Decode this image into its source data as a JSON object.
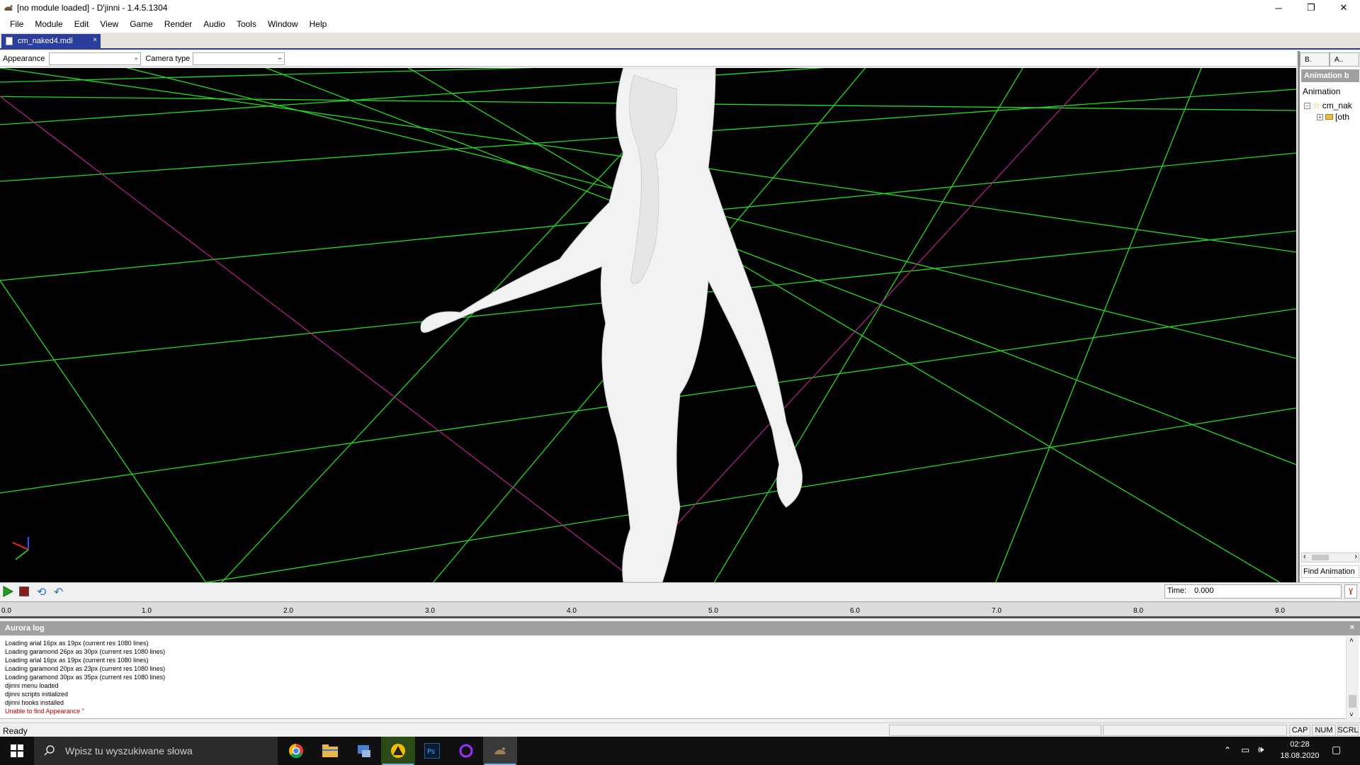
{
  "window": {
    "title": "[no module loaded] - D'jinni - 1.4.5.1304",
    "minimize_glyph": "─",
    "maximize_glyph": "❐",
    "close_glyph": "✕"
  },
  "menu": [
    "File",
    "Module",
    "Edit",
    "View",
    "Game",
    "Render",
    "Audio",
    "Tools",
    "Window",
    "Help"
  ],
  "doc_tab": {
    "label": "cm_naked4.mdl",
    "close_glyph": "×"
  },
  "toolbar": {
    "appearance_label": "Appearance",
    "appearance_value": "",
    "camera_label": "Camera type",
    "camera_value": ""
  },
  "right_panel": {
    "tabs": [
      "B.",
      "A.."
    ],
    "header": "Animation b",
    "section_label": "Animation",
    "tree": [
      {
        "label": "cm_nak",
        "icon": "star-icon",
        "expander": "−"
      },
      {
        "label": "[oth",
        "icon": "folder-icon",
        "expander": "+"
      }
    ],
    "find_label": "Find Animation"
  },
  "playback": {
    "time_label": "Time:",
    "time_value": "0.000"
  },
  "timeline": {
    "ticks": [
      "0.0",
      "1.0",
      "2.0",
      "3.0",
      "4.0",
      "5.0",
      "6.0",
      "7.0",
      "8.0",
      "9.0"
    ]
  },
  "log": {
    "title": "Aurora log",
    "close_glyph": "×",
    "lines": [
      {
        "text": "Loading arial 16px as 19px (current res 1080 lines)",
        "error": false
      },
      {
        "text": "Loading garamond 26px as 30px (current res 1080 lines)",
        "error": false
      },
      {
        "text": "Loading arial 16px as 19px (current res 1080 lines)",
        "error": false
      },
      {
        "text": "Loading garamond 20px as 23px (current res 1080 lines)",
        "error": false
      },
      {
        "text": "Loading garamond 30px as 35px (current res 1080 lines)",
        "error": false
      },
      {
        "text": "djinni menu loaded",
        "error": false
      },
      {
        "text": "djinni scripts initialized",
        "error": false
      },
      {
        "text": "djinni hooks installed",
        "error": false
      },
      {
        "text": "Unable to find Appearance ''",
        "error": true
      }
    ]
  },
  "status": {
    "text": "Ready",
    "indicators": [
      "CAP",
      "NUM",
      "SCRL"
    ]
  },
  "taskbar": {
    "search_placeholder": "Wpisz tu wyszukiwane słowa",
    "apps": [
      "chrome-icon",
      "file-explorer-icon",
      "app-icon",
      "autocad-icon",
      "photoshop-icon",
      "cortana-ring-icon",
      "djinni-icon"
    ],
    "time": "02:28",
    "date": "18.08.2020"
  },
  "colors": {
    "grid": "#22dd22",
    "axis_line": "#c02090",
    "tab_active": "#2c3e9a",
    "panel_header": "#a0a0a0",
    "log_error": "#c00000"
  }
}
